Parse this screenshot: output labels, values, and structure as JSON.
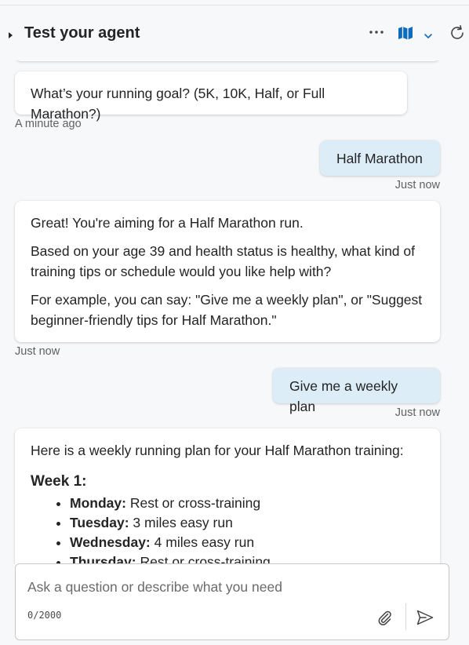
{
  "header": {
    "title": "Test your agent"
  },
  "messages": [
    {
      "role": "bot",
      "text": "What’s your running goal? (5K, 10K, Half, or Full Marathon?)",
      "time": "A minute ago"
    },
    {
      "role": "user",
      "text": "Half Marathon",
      "time": "Just now"
    },
    {
      "role": "bot",
      "paragraphs": [
        "Great! You're aiming for a Half Marathon run.",
        "Based on your age 39 and health status is healthy, what kind of training tips or schedule would you like help with?",
        "For example, you can say: \"Give me a weekly plan\", or \"Suggest beginner-friendly tips for Half Marathon.\""
      ],
      "time": "Just now"
    },
    {
      "role": "user",
      "text": "Give me a weekly plan",
      "time": "Just now"
    },
    {
      "role": "bot",
      "intro": "Here is a weekly running plan for your Half Marathon training:",
      "week": "Week 1:",
      "items": [
        {
          "day": "Monday:",
          "text": "Rest or cross-training"
        },
        {
          "day": "Tuesday:",
          "text": "3 miles easy run"
        },
        {
          "day": "Wednesday:",
          "text": "4 miles easy run"
        },
        {
          "day": "Thursday:",
          "text": "Rest or cross-training"
        }
      ]
    }
  ],
  "composer": {
    "placeholder": "Ask a question or describe what you need",
    "counter": "0/2000"
  },
  "icons": {
    "caret": "caret-right-icon",
    "more": "more-horizontal-icon",
    "map": "map-icon",
    "chevron": "chevron-down-icon",
    "refresh": "refresh-icon",
    "attach": "paperclip-icon",
    "send": "send-icon"
  },
  "colors": {
    "accent": "#0f6cbd",
    "user_bubble": "#dcedf8",
    "background": "#f7f8fa"
  }
}
